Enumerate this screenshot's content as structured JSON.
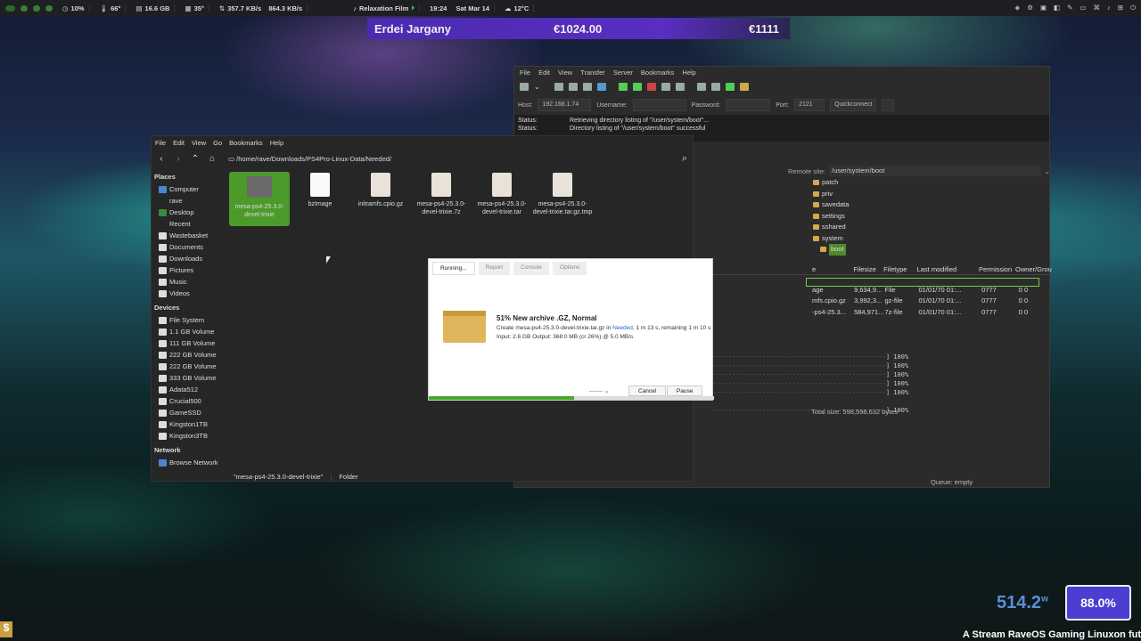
{
  "topbar": {
    "cpu": "10%",
    "temp1": "66°",
    "mem": "16.6 GB",
    "temp2": "35°",
    "down": "357.7 KB/s",
    "up": "864.3 KB/s",
    "media": "Relaxation Film",
    "time": "19:24",
    "date": "Sat Mar 14",
    "weather": "12°C"
  },
  "banner": {
    "name": "Erdei Jargany",
    "amount1": "€1024.00",
    "amount2": "€1111"
  },
  "ftp": {
    "menu": [
      "File",
      "Edit",
      "View",
      "Transfer",
      "Server",
      "Bookmarks",
      "Help"
    ],
    "host_label": "Host:",
    "host": "192.168.1.74",
    "user_label": "Username:",
    "pass_label": "Password:",
    "port_label": "Port:",
    "port": "2121",
    "quickconnect": "Quickconnect",
    "log": [
      {
        "k": "Status:",
        "v": "Retrieving directory listing of \"/user/system/boot\"..."
      },
      {
        "k": "Status:",
        "v": "Directory listing of \"/user/system/boot\" successful"
      }
    ],
    "remote_label": "Remote site:",
    "remote_path": "/user/system/boot",
    "tree": [
      "patch",
      "priv",
      "savedata",
      "settings",
      "sshared",
      "system",
      "boot"
    ],
    "col_headers": [
      "e",
      "Filesize",
      "Filetype",
      "Last modified",
      "Permission",
      "Owner/Grou"
    ],
    "rows": [
      {
        "name": "age",
        "size": "9,634,9...",
        "type": "File",
        "mod": "01/01/70 01:...",
        "perm": "0777",
        "own": "0 0"
      },
      {
        "name": "mfs.cpio.gz",
        "size": "3,992,3...",
        "type": "gz-file",
        "mod": "01/01/70 01:...",
        "perm": "0777",
        "own": "0 0"
      },
      {
        "name": "-ps4-25.3...",
        "size": "584,971...",
        "type": "7z-file",
        "mod": "01/01/70 01:...",
        "perm": "0777",
        "own": "0 0"
      }
    ],
    "progress": [
      "] 100%",
      "] 100%",
      "] 100%",
      "] 100%",
      "] 100%",
      "] 100%"
    ],
    "total": "Total size: 598,598,632 bytes",
    "queue": "Queue: empty"
  },
  "fm": {
    "menu": [
      "File",
      "Edit",
      "View",
      "Go",
      "Bookmarks",
      "Help"
    ],
    "path": "/home/rave/Downloads/PS4Pro-Linux-Data/Needed/",
    "places_title": "Places",
    "places": [
      "Computer",
      "rave",
      "Desktop",
      "Recent",
      "Wastebasket",
      "Documents",
      "Downloads",
      "Pictures",
      "Music",
      "Videos"
    ],
    "devices_title": "Devices",
    "devices": [
      "File System",
      "1.1 GB Volume",
      "111 GB Volume",
      "222 GB Volume",
      "222 GB Volume",
      "333 GB Volume",
      "Adata512",
      "Crucial500",
      "GameSSD",
      "Kingston1TB",
      "Kingston3TB"
    ],
    "network_title": "Network",
    "network": [
      "Browse Network"
    ],
    "files": [
      "mesa-ps4-25.3.0-devel-trixie",
      "bzImage",
      "initramfs.cpio.gz",
      "mesa-ps4-25.3.0-devel-trixie.7z",
      "mesa-ps4-25.3.0-devel-trixie.tar",
      "mesa-ps4-25.3.0-devel-trixie.tar.gz.tmp"
    ],
    "status_name": "\"mesa-ps4-25.3.0-devel-trixie\"",
    "status_type": "Folder"
  },
  "dialog": {
    "tabs": [
      "Running...",
      "Report",
      "Console",
      "Options"
    ],
    "title": "51% New archive .GZ, Normal",
    "line1a": "Create mesa-ps4-25.3.0-devel-trixie.tar.gz in ",
    "line1link": "Needed",
    "line1b": ", 1 m 13 s, remaining 1 m 10 s",
    "line2": "Input: 2.6 GB Output: 368.0 MB (cr 26%) @ 5.0 MB/s",
    "select": "-------",
    "cancel": "Cancel",
    "pause": "Pause",
    "progress": 0.51
  },
  "overlay": {
    "watts": "514.2",
    "watt_unit": "w",
    "percent": "88.0%",
    "credit": "A Stream RaveOS Gaming Linuxon fut",
    "dollar": "$"
  }
}
